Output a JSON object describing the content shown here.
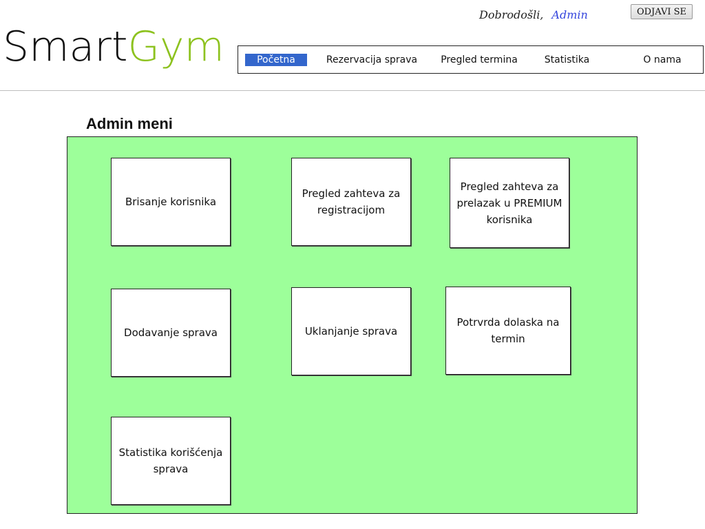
{
  "header": {
    "welcome_text": "Dobrodošli,",
    "user_name": "Admin",
    "logout_label": "ODJAVI SE",
    "logo_part1": "Smart",
    "logo_part2": "Gym"
  },
  "nav": {
    "items": [
      {
        "label": "Početna",
        "active": true
      },
      {
        "label": "Rezervacija sprava"
      },
      {
        "label": "Pregled termina"
      },
      {
        "label": "Statistika"
      },
      {
        "label": "O nama"
      }
    ]
  },
  "main": {
    "title": "Admin meni",
    "panel_color": "#9dff9a",
    "tiles": [
      {
        "label": "Brisanje korisnika"
      },
      {
        "label": "Pregled zahteva za registracijom"
      },
      {
        "label": "Pregled zahteva za prelazak u PREMIUM korisnika"
      },
      {
        "label": "Dodavanje sprava"
      },
      {
        "label": "Uklanjanje sprava"
      },
      {
        "label": "Potrvrda dolaska na termin"
      },
      {
        "label": "Statistika korišćenja sprava"
      }
    ]
  },
  "colors": {
    "accent": "#3366cc",
    "logo_green": "#8dc21f",
    "link_blue": "#3344dd"
  }
}
